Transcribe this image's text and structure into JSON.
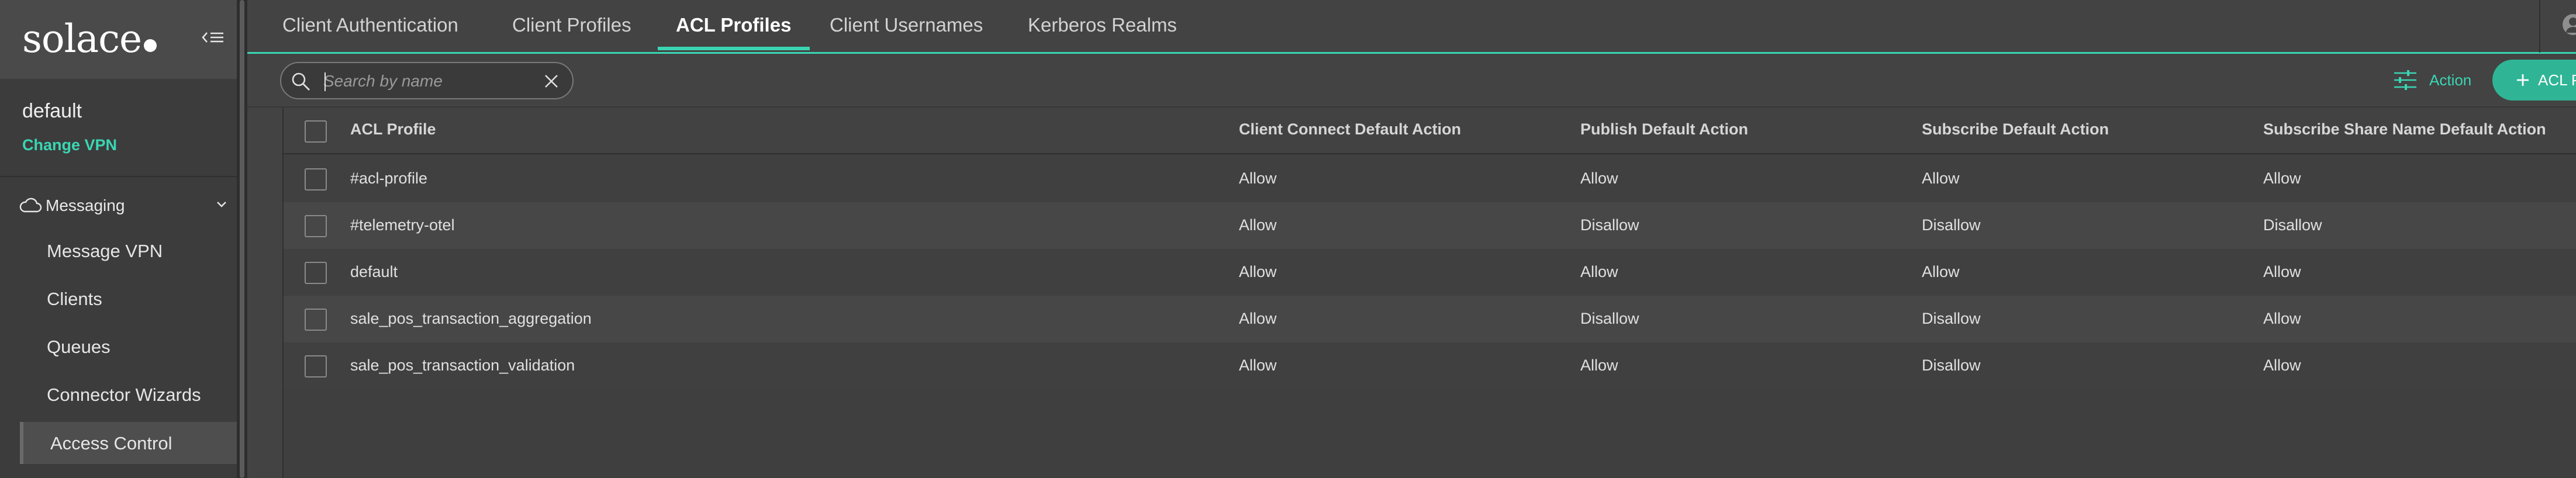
{
  "sidebar": {
    "logo_text": "solace",
    "vpn_name": "default",
    "change_vpn_label": "Change VPN",
    "group_label": "Messaging",
    "items": [
      {
        "label": "Message VPN"
      },
      {
        "label": "Clients"
      },
      {
        "label": "Queues"
      },
      {
        "label": "Connector Wizards"
      },
      {
        "label": "Access Control"
      }
    ]
  },
  "tabs": [
    {
      "label": "Client Authentication"
    },
    {
      "label": "Client Profiles"
    },
    {
      "label": "ACL Profiles",
      "active": true
    },
    {
      "label": "Client Usernames"
    },
    {
      "label": "Kerberos Realms"
    }
  ],
  "toolbar": {
    "search_placeholder": "Search by name",
    "action_label": "Action",
    "add_label": "ACL P"
  },
  "table": {
    "columns": [
      "ACL Profile",
      "Client Connect Default Action",
      "Publish Default Action",
      "Subscribe Default Action",
      "Subscribe Share Name Default Action"
    ],
    "rows": [
      [
        "#acl-profile",
        "Allow",
        "Allow",
        "Allow",
        "Allow"
      ],
      [
        "#telemetry-otel",
        "Allow",
        "Disallow",
        "Disallow",
        "Disallow"
      ],
      [
        "default",
        "Allow",
        "Allow",
        "Allow",
        "Allow"
      ],
      [
        "sale_pos_transaction_aggregation",
        "Allow",
        "Disallow",
        "Disallow",
        "Allow"
      ],
      [
        "sale_pos_transaction_validation",
        "Allow",
        "Allow",
        "Disallow",
        "Allow"
      ]
    ]
  },
  "colors": {
    "accent": "#3ad6b3",
    "add_button": "#2fb596",
    "background": "#434343",
    "sidebar": "#3c3c3c"
  },
  "icons": [
    "collapse-menu-icon",
    "cloud-icon",
    "chevron-down-icon",
    "search-icon",
    "close-icon",
    "sliders-icon",
    "plus-icon",
    "user-icon"
  ]
}
